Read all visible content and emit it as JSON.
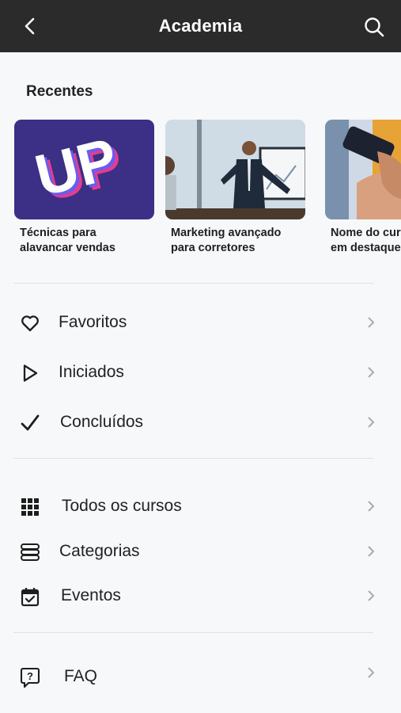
{
  "header": {
    "title": "Academia"
  },
  "recent": {
    "title": "Recentes",
    "items": [
      {
        "label": "Técnicas para\nalavancar vendas",
        "thumb_text": "UP"
      },
      {
        "label": "Marketing avançado\npara corretores"
      },
      {
        "label": "Nome do curso\nem destaque"
      }
    ]
  },
  "menu": {
    "favoritos": "Favoritos",
    "iniciados": "Iniciados",
    "concluidos": "Concluídos",
    "todos": "Todos os cursos",
    "categorias": "Categorias",
    "eventos": "Eventos",
    "faq": "FAQ"
  },
  "colors": {
    "header_bg": "#2b2b2b",
    "card_purple": "#3c2f86"
  }
}
